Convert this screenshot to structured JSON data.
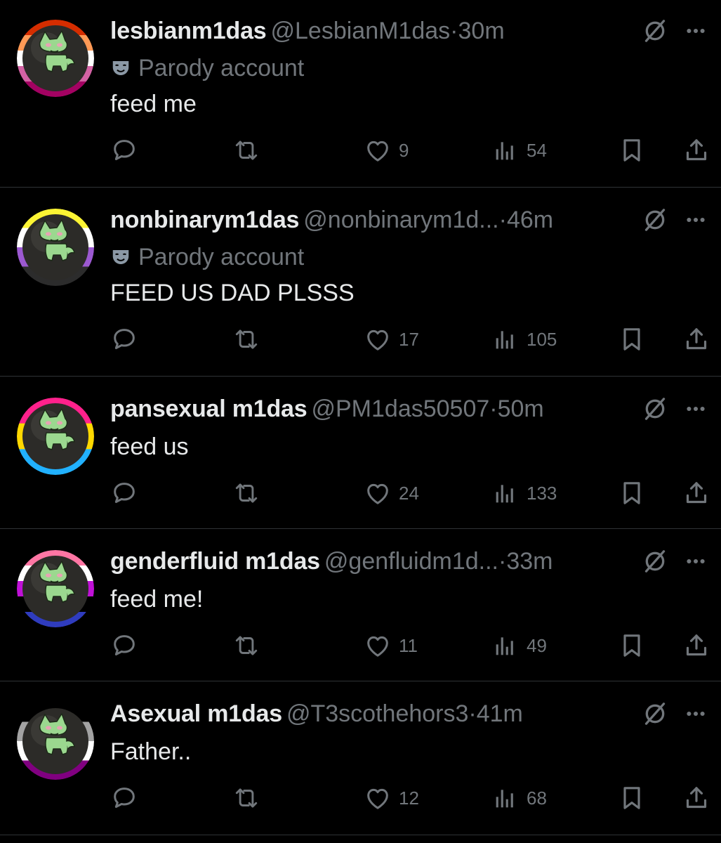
{
  "posts": [
    {
      "display_name": "lesbianm1das",
      "handle": "@LesbianM1das",
      "separator": "·",
      "time": "30m",
      "parody_label": "Parody account",
      "text": "feed me",
      "likes": "9",
      "views": "54",
      "ring_colors": [
        "#d52d00",
        "#ff9a56",
        "#ffffff",
        "#d362a4",
        "#a30262"
      ],
      "show_parody": true
    },
    {
      "display_name": "nonbinarym1das",
      "handle": "@nonbinarym1d...",
      "separator": "·",
      "time": "46m",
      "parody_label": "Parody account",
      "text": "FEED US DAD PLSSS",
      "likes": "17",
      "views": "105",
      "ring_colors": [
        "#fcf434",
        "#ffffff",
        "#9c59d1",
        "#2c2c2c"
      ],
      "show_parody": true
    },
    {
      "display_name": "pansexual m1das",
      "handle": "@PM1das50507",
      "separator": "·",
      "time": "50m",
      "parody_label": "",
      "text": "feed us",
      "likes": "24",
      "views": "133",
      "ring_colors": [
        "#ff218c",
        "#ffd800",
        "#21b1ff"
      ],
      "show_parody": false
    },
    {
      "display_name": "genderfluid m1das",
      "handle": "@genfluidm1d...",
      "separator": "·",
      "time": "33m",
      "parody_label": "",
      "text": "feed me!",
      "likes": "11",
      "views": "49",
      "ring_colors": [
        "#ff76a4",
        "#ffffff",
        "#c011d7",
        "#000000",
        "#2f3cbe"
      ],
      "show_parody": false
    },
    {
      "display_name": "Asexual m1das",
      "handle": "@T3scothehors3",
      "separator": "·",
      "time": "41m",
      "parody_label": "",
      "text": "Father..",
      "likes": "12",
      "views": "68",
      "ring_colors": [
        "#000000",
        "#a3a3a3",
        "#ffffff",
        "#800080"
      ],
      "show_parody": false
    }
  ],
  "icons": {
    "reply": "reply-icon",
    "repost": "repost-icon",
    "like": "heart-icon",
    "views": "views-icon",
    "bookmark": "bookmark-icon",
    "share": "share-icon",
    "grok": "grok-icon",
    "more": "more-icon",
    "parody": "mask-icon"
  },
  "colors": {
    "background": "#000000",
    "text": "#e7e9ea",
    "muted": "#71767b",
    "divider": "#2f3336"
  }
}
